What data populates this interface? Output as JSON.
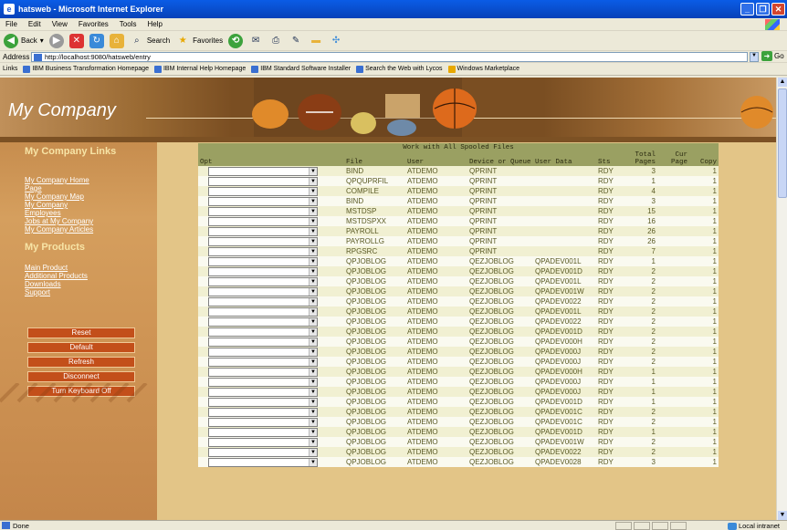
{
  "window": {
    "title": "hatsweb - Microsoft Internet Explorer",
    "app_icon": "ie-icon"
  },
  "menu": [
    "File",
    "Edit",
    "View",
    "Favorites",
    "Tools",
    "Help"
  ],
  "toolbar": {
    "back": "Back",
    "search": "Search",
    "favorites": "Favorites"
  },
  "address": {
    "label": "Address",
    "url": "http://localhost:9080/hatsweb/entry",
    "go": "Go"
  },
  "links": {
    "label": "Links",
    "items": [
      "IBM Business Transformation Homepage",
      "IBM Internal Help Homepage",
      "IBM Standard Software Installer",
      "Search the Web with Lycos",
      "Windows Marketplace"
    ]
  },
  "status": {
    "left": "Done",
    "zone": "Local intranet"
  },
  "page": {
    "brand": "My Company",
    "sidebar": {
      "links_heading": "My Company Links",
      "links": [
        "My Company Home Page",
        "My Company Map",
        "My Company Employees",
        "Jobs at My Company",
        "My Company Articles"
      ],
      "products_heading": "My Products",
      "products": [
        "Main Product",
        "Additional Products",
        "Downloads",
        "Support"
      ],
      "buttons": [
        "Reset",
        "Default",
        "Refresh",
        "Disconnect",
        "Turn Keyboard Off"
      ]
    },
    "table": {
      "title": "Work with All Spooled Files",
      "headers": {
        "opt": "Opt",
        "file": "File",
        "user": "User",
        "device": "Device or Queue",
        "userdata": "User Data",
        "sts": "Sts",
        "total": "Total Pages",
        "cur": "Cur Page",
        "copy": "Copy"
      },
      "rows": [
        {
          "file": "BIND",
          "user": "ATDEMO",
          "device": "QPRINT",
          "userdata": "",
          "sts": "RDY",
          "total": "3",
          "cur": "",
          "copy": "1"
        },
        {
          "file": "QPQUPRFIL",
          "user": "ATDEMO",
          "device": "QPRINT",
          "userdata": "",
          "sts": "RDY",
          "total": "1",
          "cur": "",
          "copy": "1"
        },
        {
          "file": "COMPILE",
          "user": "ATDEMO",
          "device": "QPRINT",
          "userdata": "",
          "sts": "RDY",
          "total": "4",
          "cur": "",
          "copy": "1"
        },
        {
          "file": "BIND",
          "user": "ATDEMO",
          "device": "QPRINT",
          "userdata": "",
          "sts": "RDY",
          "total": "3",
          "cur": "",
          "copy": "1"
        },
        {
          "file": "MSTDSP",
          "user": "ATDEMO",
          "device": "QPRINT",
          "userdata": "",
          "sts": "RDY",
          "total": "15",
          "cur": "",
          "copy": "1"
        },
        {
          "file": "MSTDSPXX",
          "user": "ATDEMO",
          "device": "QPRINT",
          "userdata": "",
          "sts": "RDY",
          "total": "16",
          "cur": "",
          "copy": "1"
        },
        {
          "file": "PAYROLL",
          "user": "ATDEMO",
          "device": "QPRINT",
          "userdata": "",
          "sts": "RDY",
          "total": "26",
          "cur": "",
          "copy": "1"
        },
        {
          "file": "PAYROLLG",
          "user": "ATDEMO",
          "device": "QPRINT",
          "userdata": "",
          "sts": "RDY",
          "total": "26",
          "cur": "",
          "copy": "1"
        },
        {
          "file": "RPGSRC",
          "user": "ATDEMO",
          "device": "QPRINT",
          "userdata": "",
          "sts": "RDY",
          "total": "7",
          "cur": "",
          "copy": "1"
        },
        {
          "file": "QPJOBLOG",
          "user": "ATDEMO",
          "device": "QEZJOBLOG",
          "userdata": "QPADEV001L",
          "sts": "RDY",
          "total": "1",
          "cur": "",
          "copy": "1"
        },
        {
          "file": "QPJOBLOG",
          "user": "ATDEMO",
          "device": "QEZJOBLOG",
          "userdata": "QPADEV001D",
          "sts": "RDY",
          "total": "2",
          "cur": "",
          "copy": "1"
        },
        {
          "file": "QPJOBLOG",
          "user": "ATDEMO",
          "device": "QEZJOBLOG",
          "userdata": "QPADEV001L",
          "sts": "RDY",
          "total": "2",
          "cur": "",
          "copy": "1"
        },
        {
          "file": "QPJOBLOG",
          "user": "ATDEMO",
          "device": "QEZJOBLOG",
          "userdata": "QPADEV001W",
          "sts": "RDY",
          "total": "2",
          "cur": "",
          "copy": "1"
        },
        {
          "file": "QPJOBLOG",
          "user": "ATDEMO",
          "device": "QEZJOBLOG",
          "userdata": "QPADEV0022",
          "sts": "RDY",
          "total": "2",
          "cur": "",
          "copy": "1"
        },
        {
          "file": "QPJOBLOG",
          "user": "ATDEMO",
          "device": "QEZJOBLOG",
          "userdata": "QPADEV001L",
          "sts": "RDY",
          "total": "2",
          "cur": "",
          "copy": "1"
        },
        {
          "file": "QPJOBLOG",
          "user": "ATDEMO",
          "device": "QEZJOBLOG",
          "userdata": "QPADEV0022",
          "sts": "RDY",
          "total": "2",
          "cur": "",
          "copy": "1"
        },
        {
          "file": "QPJOBLOG",
          "user": "ATDEMO",
          "device": "QEZJOBLOG",
          "userdata": "QPADEV001D",
          "sts": "RDY",
          "total": "2",
          "cur": "",
          "copy": "1"
        },
        {
          "file": "QPJOBLOG",
          "user": "ATDEMO",
          "device": "QEZJOBLOG",
          "userdata": "QPADEV000H",
          "sts": "RDY",
          "total": "2",
          "cur": "",
          "copy": "1"
        },
        {
          "file": "QPJOBLOG",
          "user": "ATDEMO",
          "device": "QEZJOBLOG",
          "userdata": "QPADEV000J",
          "sts": "RDY",
          "total": "2",
          "cur": "",
          "copy": "1"
        },
        {
          "file": "QPJOBLOG",
          "user": "ATDEMO",
          "device": "QEZJOBLOG",
          "userdata": "QPADEV000J",
          "sts": "RDY",
          "total": "2",
          "cur": "",
          "copy": "1"
        },
        {
          "file": "QPJOBLOG",
          "user": "ATDEMO",
          "device": "QEZJOBLOG",
          "userdata": "QPADEV000H",
          "sts": "RDY",
          "total": "1",
          "cur": "",
          "copy": "1"
        },
        {
          "file": "QPJOBLOG",
          "user": "ATDEMO",
          "device": "QEZJOBLOG",
          "userdata": "QPADEV000J",
          "sts": "RDY",
          "total": "1",
          "cur": "",
          "copy": "1"
        },
        {
          "file": "QPJOBLOG",
          "user": "ATDEMO",
          "device": "QEZJOBLOG",
          "userdata": "QPADEV000J",
          "sts": "RDY",
          "total": "1",
          "cur": "",
          "copy": "1"
        },
        {
          "file": "QPJOBLOG",
          "user": "ATDEMO",
          "device": "QEZJOBLOG",
          "userdata": "QPADEV001D",
          "sts": "RDY",
          "total": "1",
          "cur": "",
          "copy": "1"
        },
        {
          "file": "QPJOBLOG",
          "user": "ATDEMO",
          "device": "QEZJOBLOG",
          "userdata": "QPADEV001C",
          "sts": "RDY",
          "total": "2",
          "cur": "",
          "copy": "1"
        },
        {
          "file": "QPJOBLOG",
          "user": "ATDEMO",
          "device": "QEZJOBLOG",
          "userdata": "QPADEV001C",
          "sts": "RDY",
          "total": "2",
          "cur": "",
          "copy": "1"
        },
        {
          "file": "QPJOBLOG",
          "user": "ATDEMO",
          "device": "QEZJOBLOG",
          "userdata": "QPADEV001D",
          "sts": "RDY",
          "total": "1",
          "cur": "",
          "copy": "1"
        },
        {
          "file": "QPJOBLOG",
          "user": "ATDEMO",
          "device": "QEZJOBLOG",
          "userdata": "QPADEV001W",
          "sts": "RDY",
          "total": "2",
          "cur": "",
          "copy": "1"
        },
        {
          "file": "QPJOBLOG",
          "user": "ATDEMO",
          "device": "QEZJOBLOG",
          "userdata": "QPADEV0022",
          "sts": "RDY",
          "total": "2",
          "cur": "",
          "copy": "1"
        },
        {
          "file": "QPJOBLOG",
          "user": "ATDEMO",
          "device": "QEZJOBLOG",
          "userdata": "QPADEV0028",
          "sts": "RDY",
          "total": "3",
          "cur": "",
          "copy": "1"
        }
      ]
    }
  },
  "colors": {
    "banner": "#7a4e22",
    "sidebar": "#d59f5e",
    "table_header": "#9aa062",
    "button": "#c34f1a"
  }
}
